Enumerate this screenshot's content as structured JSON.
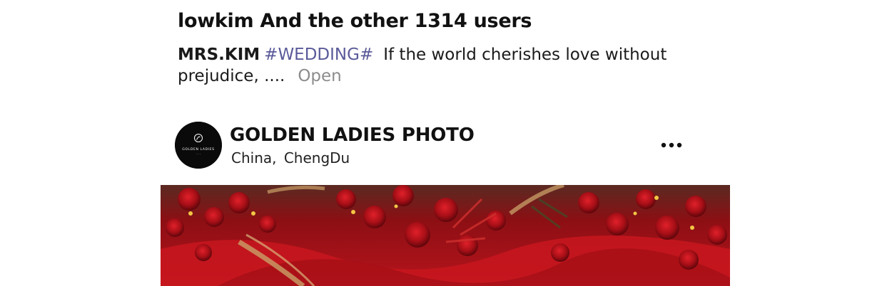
{
  "likes": {
    "text": "lowkim And the other 1314 users"
  },
  "caption": {
    "author": "MRS.KIM",
    "hashtag": "#WEDDING#",
    "text": "If the world cherishes love without prejudice, ....",
    "open_label": "Open"
  },
  "post": {
    "account_name": "GOLDEN LADIES PHOTO",
    "location": "China, ChengDu",
    "avatar_logo_text": "GOLDEN LADIES",
    "more_icon": "more-dots-icon",
    "image_subject": "red-rose-wedding-decoration"
  },
  "colors": {
    "hashtag": "#5a5a9a",
    "open_link": "#8c8c8c",
    "avatar_bg": "#0a0a0a",
    "image_primary": "#a3121a"
  }
}
